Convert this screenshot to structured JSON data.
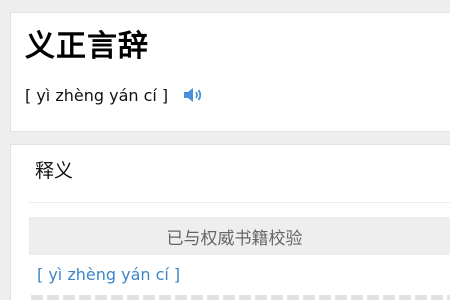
{
  "word": {
    "title": "义正言辞",
    "pinyin": "[ yì zhèng yán cí ]"
  },
  "definition": {
    "heading": "释义",
    "verified_label": "已与权威书籍校验",
    "pinyin_link": "[ yì zhèng yán cí ]"
  },
  "colors": {
    "accent": "#3a86c8",
    "speaker": "#4a90d9"
  },
  "icons": {
    "speaker": "speaker-icon",
    "side": "partial-side-icon"
  }
}
